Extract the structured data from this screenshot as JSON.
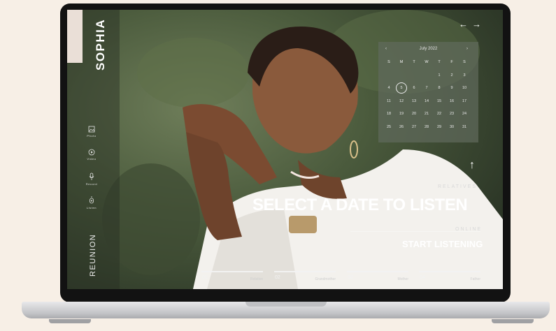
{
  "app": {
    "name": "SOPHIA",
    "logo": "REUNION"
  },
  "sidebar": {
    "items": [
      {
        "label": "Photo",
        "icon": "image-icon"
      },
      {
        "label": "Video",
        "icon": "play-icon"
      },
      {
        "label": "Record",
        "icon": "mic-icon"
      },
      {
        "label": "Listen",
        "icon": "listen-icon"
      }
    ]
  },
  "nav_arrows": {
    "prev": "←",
    "next": "→"
  },
  "calendar": {
    "month": "July 2022",
    "prev": "‹",
    "next": "›",
    "weekdays": [
      "S",
      "M",
      "T",
      "W",
      "T",
      "F",
      "S"
    ],
    "weeks": [
      [
        "",
        "",
        "",
        "",
        "1",
        "2",
        "3"
      ],
      [
        "4",
        "5",
        "6",
        "7",
        "8",
        "9",
        "10"
      ],
      [
        "11",
        "12",
        "13",
        "14",
        "15",
        "16",
        "17"
      ],
      [
        "18",
        "19",
        "20",
        "21",
        "22",
        "23",
        "24"
      ],
      [
        "25",
        "26",
        "27",
        "28",
        "29",
        "30",
        "31"
      ]
    ],
    "selected_day": "5"
  },
  "scroll_up": "↑",
  "hero": {
    "category_top": "RELATIVES",
    "headline": "SELECT A DATE TO LISTEN",
    "category_bottom": "ONLINE",
    "cta": "START LISTENING"
  },
  "tracks": [
    {
      "number": "01",
      "label": "Relative"
    },
    {
      "number": "02",
      "label": "Grandmother"
    },
    {
      "number": "03",
      "label": "Mother"
    },
    {
      "number": "04",
      "label": "Father"
    }
  ],
  "colors": {
    "background": "#f7efe6",
    "accent_bar": "#eadfd7",
    "text": "#ffffff"
  }
}
